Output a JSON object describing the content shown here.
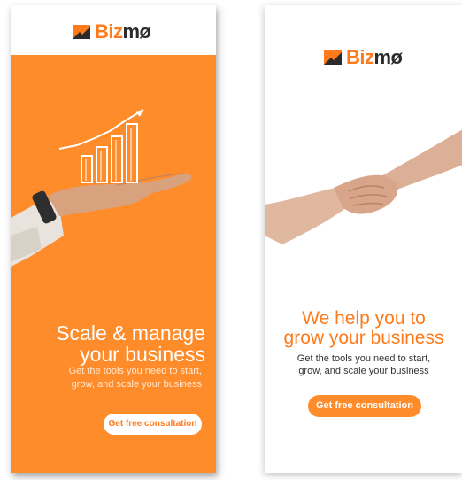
{
  "colors": {
    "brand_orange": "#ff8c2b",
    "brand_orange_text": "#ff7a1a",
    "white": "#ffffff",
    "dark_text": "#2b2b2b"
  },
  "left_banner": {
    "logo_prefix": "Biz",
    "logo_suffix": "mø",
    "headline_line1": "Scale & manage",
    "headline_line2": "your business",
    "subtext_line1": "Get the tools you need to start,",
    "subtext_line2": "grow, and scale your business",
    "cta_label": "Get free consultation"
  },
  "right_banner": {
    "logo_prefix": "Biz",
    "logo_suffix": "mø",
    "headline_line1": "We help you to",
    "headline_line2": "grow your business",
    "subtext_line1": "Get the tools you need to start,",
    "subtext_line2": "grow, and scale your business",
    "cta_label": "Get free consultation"
  }
}
